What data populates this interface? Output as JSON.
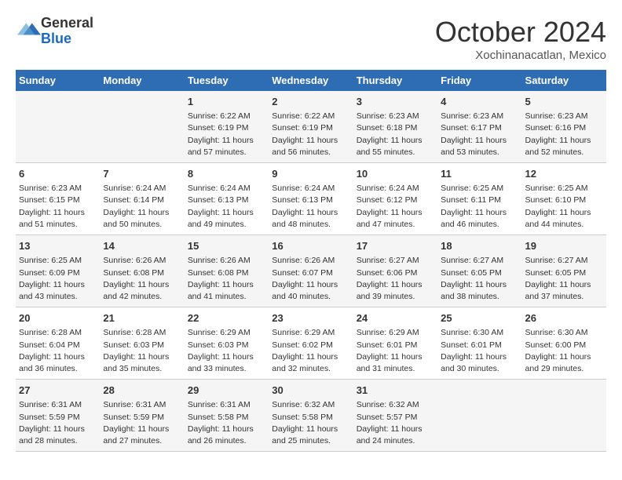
{
  "header": {
    "logo_line1": "General",
    "logo_line2": "Blue",
    "month": "October 2024",
    "location": "Xochinanacatlan, Mexico"
  },
  "columns": [
    "Sunday",
    "Monday",
    "Tuesday",
    "Wednesday",
    "Thursday",
    "Friday",
    "Saturday"
  ],
  "weeks": [
    [
      {
        "day": "",
        "info": ""
      },
      {
        "day": "",
        "info": ""
      },
      {
        "day": "1",
        "info": "Sunrise: 6:22 AM\nSunset: 6:19 PM\nDaylight: 11 hours and 57 minutes."
      },
      {
        "day": "2",
        "info": "Sunrise: 6:22 AM\nSunset: 6:19 PM\nDaylight: 11 hours and 56 minutes."
      },
      {
        "day": "3",
        "info": "Sunrise: 6:23 AM\nSunset: 6:18 PM\nDaylight: 11 hours and 55 minutes."
      },
      {
        "day": "4",
        "info": "Sunrise: 6:23 AM\nSunset: 6:17 PM\nDaylight: 11 hours and 53 minutes."
      },
      {
        "day": "5",
        "info": "Sunrise: 6:23 AM\nSunset: 6:16 PM\nDaylight: 11 hours and 52 minutes."
      }
    ],
    [
      {
        "day": "6",
        "info": "Sunrise: 6:23 AM\nSunset: 6:15 PM\nDaylight: 11 hours and 51 minutes."
      },
      {
        "day": "7",
        "info": "Sunrise: 6:24 AM\nSunset: 6:14 PM\nDaylight: 11 hours and 50 minutes."
      },
      {
        "day": "8",
        "info": "Sunrise: 6:24 AM\nSunset: 6:13 PM\nDaylight: 11 hours and 49 minutes."
      },
      {
        "day": "9",
        "info": "Sunrise: 6:24 AM\nSunset: 6:13 PM\nDaylight: 11 hours and 48 minutes."
      },
      {
        "day": "10",
        "info": "Sunrise: 6:24 AM\nSunset: 6:12 PM\nDaylight: 11 hours and 47 minutes."
      },
      {
        "day": "11",
        "info": "Sunrise: 6:25 AM\nSunset: 6:11 PM\nDaylight: 11 hours and 46 minutes."
      },
      {
        "day": "12",
        "info": "Sunrise: 6:25 AM\nSunset: 6:10 PM\nDaylight: 11 hours and 44 minutes."
      }
    ],
    [
      {
        "day": "13",
        "info": "Sunrise: 6:25 AM\nSunset: 6:09 PM\nDaylight: 11 hours and 43 minutes."
      },
      {
        "day": "14",
        "info": "Sunrise: 6:26 AM\nSunset: 6:08 PM\nDaylight: 11 hours and 42 minutes."
      },
      {
        "day": "15",
        "info": "Sunrise: 6:26 AM\nSunset: 6:08 PM\nDaylight: 11 hours and 41 minutes."
      },
      {
        "day": "16",
        "info": "Sunrise: 6:26 AM\nSunset: 6:07 PM\nDaylight: 11 hours and 40 minutes."
      },
      {
        "day": "17",
        "info": "Sunrise: 6:27 AM\nSunset: 6:06 PM\nDaylight: 11 hours and 39 minutes."
      },
      {
        "day": "18",
        "info": "Sunrise: 6:27 AM\nSunset: 6:05 PM\nDaylight: 11 hours and 38 minutes."
      },
      {
        "day": "19",
        "info": "Sunrise: 6:27 AM\nSunset: 6:05 PM\nDaylight: 11 hours and 37 minutes."
      }
    ],
    [
      {
        "day": "20",
        "info": "Sunrise: 6:28 AM\nSunset: 6:04 PM\nDaylight: 11 hours and 36 minutes."
      },
      {
        "day": "21",
        "info": "Sunrise: 6:28 AM\nSunset: 6:03 PM\nDaylight: 11 hours and 35 minutes."
      },
      {
        "day": "22",
        "info": "Sunrise: 6:29 AM\nSunset: 6:03 PM\nDaylight: 11 hours and 33 minutes."
      },
      {
        "day": "23",
        "info": "Sunrise: 6:29 AM\nSunset: 6:02 PM\nDaylight: 11 hours and 32 minutes."
      },
      {
        "day": "24",
        "info": "Sunrise: 6:29 AM\nSunset: 6:01 PM\nDaylight: 11 hours and 31 minutes."
      },
      {
        "day": "25",
        "info": "Sunrise: 6:30 AM\nSunset: 6:01 PM\nDaylight: 11 hours and 30 minutes."
      },
      {
        "day": "26",
        "info": "Sunrise: 6:30 AM\nSunset: 6:00 PM\nDaylight: 11 hours and 29 minutes."
      }
    ],
    [
      {
        "day": "27",
        "info": "Sunrise: 6:31 AM\nSunset: 5:59 PM\nDaylight: 11 hours and 28 minutes."
      },
      {
        "day": "28",
        "info": "Sunrise: 6:31 AM\nSunset: 5:59 PM\nDaylight: 11 hours and 27 minutes."
      },
      {
        "day": "29",
        "info": "Sunrise: 6:31 AM\nSunset: 5:58 PM\nDaylight: 11 hours and 26 minutes."
      },
      {
        "day": "30",
        "info": "Sunrise: 6:32 AM\nSunset: 5:58 PM\nDaylight: 11 hours and 25 minutes."
      },
      {
        "day": "31",
        "info": "Sunrise: 6:32 AM\nSunset: 5:57 PM\nDaylight: 11 hours and 24 minutes."
      },
      {
        "day": "",
        "info": ""
      },
      {
        "day": "",
        "info": ""
      }
    ]
  ]
}
